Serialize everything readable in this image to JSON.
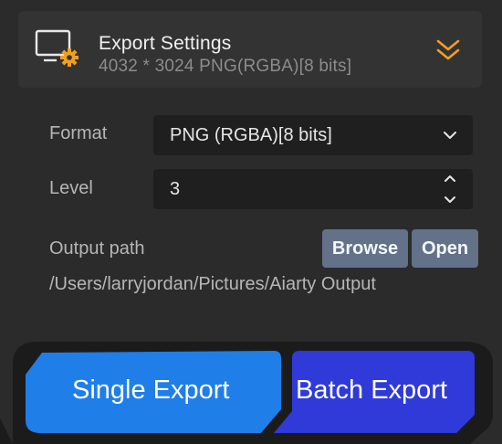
{
  "header": {
    "title": "Export Settings",
    "subtitle": "4032 * 3024 PNG(RGBA)[8 bits]"
  },
  "form": {
    "format_label": "Format",
    "format_value": "PNG (RGBA)[8 bits]",
    "level_label": "Level",
    "level_value": "3",
    "output_label": "Output path",
    "browse_label": "Browse",
    "open_label": "Open",
    "output_path": "/Users/larryjordan/Pictures/Aiarty Output"
  },
  "actions": {
    "single_export_label": "Single Export",
    "batch_export_label": "Batch Export"
  },
  "colors": {
    "accent_orange": "#f0a020",
    "single_export_blue": "#1f7ee8",
    "batch_export_blue": "#2f3ad8",
    "button_gray_blue": "#637189"
  },
  "icons": {
    "header": "monitor-gear-icon",
    "collapse": "double-chevron-down-icon",
    "format_dropdown": "chevron-down-icon",
    "level_stepper": "up-down-stepper-icon"
  }
}
